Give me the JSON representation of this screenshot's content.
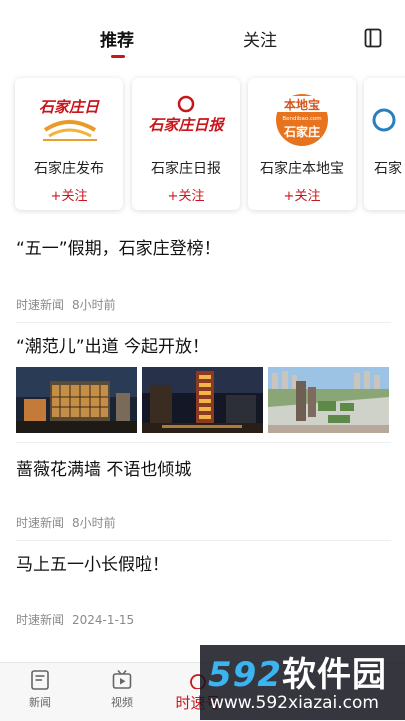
{
  "tabs": {
    "recommend": "推荐",
    "follow": "关注"
  },
  "cards": [
    {
      "name": "石家庄发布",
      "follow": "+关注",
      "logo_text": "石家庄日"
    },
    {
      "name": "石家庄日报",
      "follow": "+关注",
      "logo_text": "石家庄日报"
    },
    {
      "name": "石家庄本地宝",
      "follow": "+关注",
      "logo_text_top": "本地宝",
      "logo_text_url": "Bendibao.com",
      "logo_text_bottom": "石家庄"
    },
    {
      "name": "石家",
      "follow": ""
    }
  ],
  "feed": [
    {
      "title": "“五一”假期，石家庄登榜！",
      "source": "时速新闻",
      "time": "8小时前"
    },
    {
      "title": "“潮范儿”出道 今起开放！"
    },
    {
      "title": "蔷薇花满墙  不语也倾城",
      "source": "时速新闻",
      "time": "8小时前"
    },
    {
      "title": "马上五一小长假啦！",
      "source": "时速新闻",
      "time": "2024-1-15"
    }
  ],
  "nav": {
    "news": "新闻",
    "video": "视频",
    "active": "时速号"
  },
  "watermark": {
    "big_num": "592",
    "big_text": "软件园",
    "small": "www.592xiazai.com"
  },
  "colors": {
    "accent": "#c8161d",
    "bendibao_orange": "#e8731f"
  }
}
